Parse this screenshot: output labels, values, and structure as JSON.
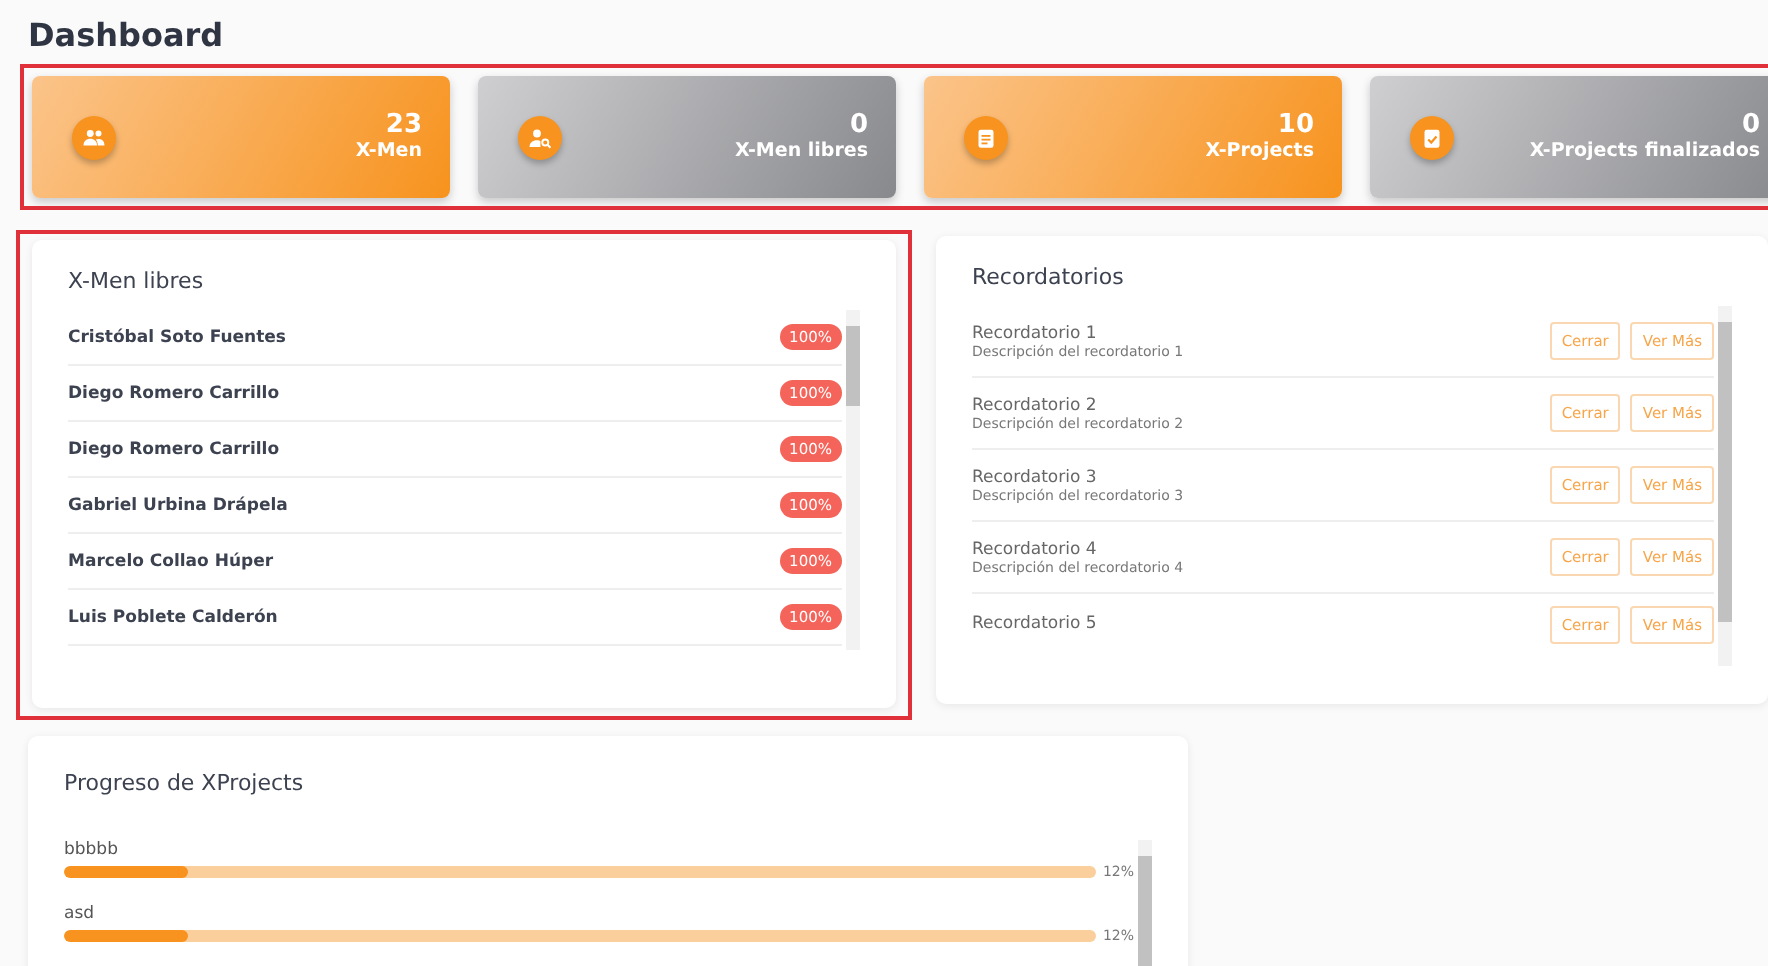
{
  "title": "Dashboard",
  "stats": {
    "highlighted": true,
    "cards": [
      {
        "value": "23",
        "label": "X-Men",
        "kind": "orange"
      },
      {
        "value": "0",
        "label": "X-Men libres",
        "kind": "grey"
      },
      {
        "value": "10",
        "label": "X-Projects",
        "kind": "orange"
      },
      {
        "value": "0",
        "label": "X-Projects finalizados",
        "kind": "grey"
      }
    ]
  },
  "xmen_libres": {
    "highlighted": true,
    "title": "X-Men libres",
    "rows": [
      {
        "name": "Cristóbal Soto Fuentes",
        "badge": "100%"
      },
      {
        "name": "Diego Romero Carrillo",
        "badge": "100%"
      },
      {
        "name": "Diego Romero Carrillo",
        "badge": "100%"
      },
      {
        "name": "Gabriel Urbina Drápela",
        "badge": "100%"
      },
      {
        "name": "Marcelo Collao Húper",
        "badge": "100%"
      },
      {
        "name": "Luis Poblete Calderón",
        "badge": "100%"
      }
    ]
  },
  "recordatorios": {
    "title": "Recordatorios",
    "items": [
      {
        "title": "Recordatorio 1",
        "description": "Descripción del recordatorio 1",
        "buttons": [
          "Cerrar",
          "Ver Más"
        ]
      },
      {
        "title": "Recordatorio 2",
        "description": "Descripción del recordatorio 2",
        "buttons": [
          "Cerrar",
          "Ver Más"
        ]
      },
      {
        "title": "Recordatorio 3",
        "description": "Descripción del recordatorio 3",
        "buttons": [
          "Cerrar",
          "Ver Más"
        ]
      },
      {
        "title": "Recordatorio 4",
        "description": "Descripción del recordatorio 4",
        "buttons": [
          "Cerrar",
          "Ver Más"
        ]
      },
      {
        "title": "Recordatorio 5",
        "buttons": [
          "Cerrar",
          "Ver Más"
        ]
      }
    ]
  },
  "progreso": {
    "title": "Progreso de XProjects",
    "items": [
      {
        "name": "bbbbb",
        "level": 0.12,
        "reading": "12%"
      },
      {
        "name": "asd",
        "level": 0.12,
        "reading": "12%"
      }
    ]
  }
}
